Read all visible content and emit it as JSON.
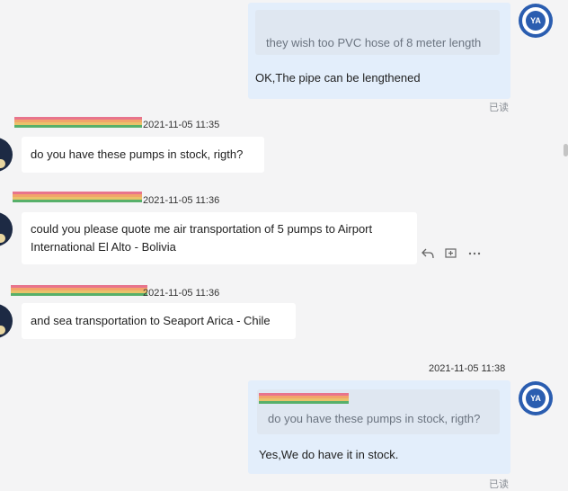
{
  "messages": [
    {
      "quote": "they wish too PVC hose of 8 meter length",
      "text": "OK,The pipe can be lengthened",
      "status": "已读"
    },
    {
      "timestamp": "2021-11-05 11:35",
      "text": "do you have these pumps in stock, rigth?"
    },
    {
      "timestamp": "2021-11-05 11:36",
      "text_line1": "could you please quote me air transportation of 5 pumps to Airport",
      "text_line2": "International El Alto - Bolivia"
    },
    {
      "timestamp": "2021-11-05 11:36",
      "text": "and sea transportation to Seaport Arica - Chile"
    },
    {
      "timestamp": "2021-11-05 11:38",
      "quote": "do you have these pumps in stock, rigth?",
      "text": "Yes,We do have it in stock.",
      "status": "已读"
    }
  ],
  "icons": {
    "reply": "reply-icon",
    "add_task": "add-to-task-icon",
    "more": "more-icon"
  },
  "brand_avatar_letters": "YA",
  "colors": {
    "outgoing_bubble": "#e3eefb",
    "incoming_bubble": "#ffffff",
    "background": "#f4f4f5",
    "brand": "#2a5db0"
  }
}
